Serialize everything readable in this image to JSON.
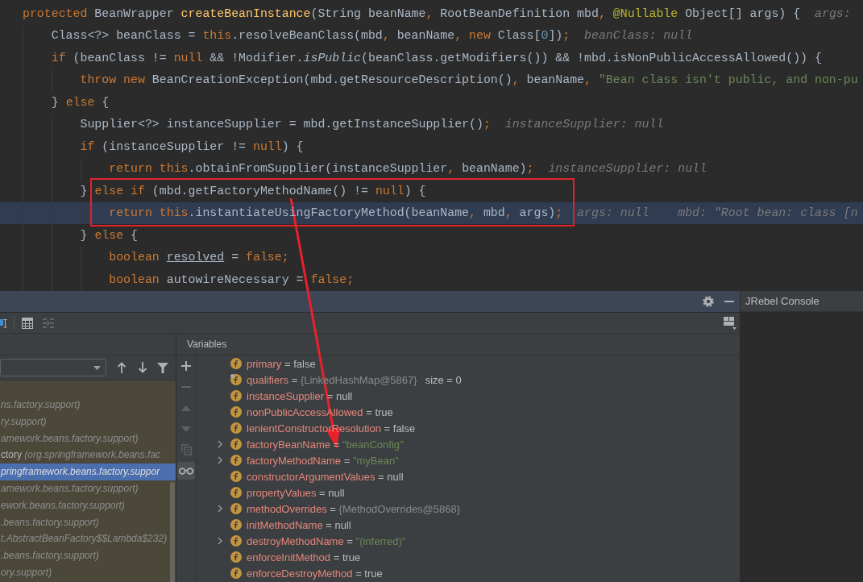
{
  "editor": {
    "lines": [
      {
        "tokens": [
          {
            "text": "protected",
            "kind": "keyword"
          },
          {
            "text": " BeanWrapper ",
            "kind": "plain"
          },
          {
            "text": "createBeanInstance",
            "kind": "method"
          },
          {
            "text": "(String beanName",
            "kind": "plain"
          },
          {
            "text": ", ",
            "kind": "punct"
          },
          {
            "text": "RootBeanDefinition mbd",
            "kind": "plain"
          },
          {
            "text": ", ",
            "kind": "punct"
          },
          {
            "text": "@Nullable",
            "kind": "annotation"
          },
          {
            "text": " Object[] args) {",
            "kind": "plain"
          }
        ],
        "hints": [
          "args:"
        ],
        "current": false,
        "children": [
          {
            "tokens": [
              {
                "text": "Class<?> beanClass = ",
                "kind": "plain"
              },
              {
                "text": "this",
                "kind": "keyword"
              },
              {
                "text": ".resolveBeanClass(mbd",
                "kind": "plain"
              },
              {
                "text": ", ",
                "kind": "punct"
              },
              {
                "text": "beanName",
                "kind": "plain"
              },
              {
                "text": ", ",
                "kind": "punct"
              },
              {
                "text": "new",
                "kind": "keyword"
              },
              {
                "text": " Class[",
                "kind": "plain"
              },
              {
                "text": "0",
                "kind": "number"
              },
              {
                "text": "])",
                "kind": "plain"
              },
              {
                "text": ";",
                "kind": "punct"
              }
            ],
            "hints": [
              "beanClass: null"
            ],
            "current": false
          },
          {
            "tokens": [
              {
                "text": "if",
                "kind": "keyword"
              },
              {
                "text": " (beanClass != ",
                "kind": "plain"
              },
              {
                "text": "null",
                "kind": "keyword"
              },
              {
                "text": " && !Modifier.",
                "kind": "plain"
              },
              {
                "text": "isPublic",
                "kind": "static"
              },
              {
                "text": "(beanClass.getModifiers()) && !mbd.isNonPublicAccessAllowed()) {",
                "kind": "plain"
              }
            ],
            "current": false,
            "children": [
              {
                "tokens": [
                  {
                    "text": "throw new",
                    "kind": "keyword"
                  },
                  {
                    "text": " BeanCreationException(mbd.getResourceDescription()",
                    "kind": "plain"
                  },
                  {
                    "text": ", ",
                    "kind": "punct"
                  },
                  {
                    "text": "beanName",
                    "kind": "plain"
                  },
                  {
                    "text": ", ",
                    "kind": "punct"
                  },
                  {
                    "text": "\"Bean class isn't public, and non-pu",
                    "kind": "string"
                  }
                ],
                "current": false
              }
            ]
          },
          {
            "tokens": [
              {
                "text": "} ",
                "kind": "plain"
              },
              {
                "text": "else",
                "kind": "keyword"
              },
              {
                "text": " {",
                "kind": "plain"
              }
            ],
            "current": false,
            "children": [
              {
                "tokens": [
                  {
                    "text": "Supplier<?> instanceSupplier = mbd.getInstanceSupplier()",
                    "kind": "plain"
                  },
                  {
                    "text": ";",
                    "kind": "punct"
                  }
                ],
                "hints": [
                  "instanceSupplier: null"
                ],
                "current": false
              },
              {
                "tokens": [
                  {
                    "text": "if",
                    "kind": "keyword"
                  },
                  {
                    "text": " (instanceSupplier != ",
                    "kind": "plain"
                  },
                  {
                    "text": "null",
                    "kind": "keyword"
                  },
                  {
                    "text": ") {",
                    "kind": "plain"
                  }
                ],
                "current": false,
                "children": [
                  {
                    "tokens": [
                      {
                        "text": "return this",
                        "kind": "keyword"
                      },
                      {
                        "text": ".obtainFromSupplier(instanceSupplier",
                        "kind": "plain"
                      },
                      {
                        "text": ", ",
                        "kind": "punct"
                      },
                      {
                        "text": "beanName)",
                        "kind": "plain"
                      },
                      {
                        "text": ";",
                        "kind": "punct"
                      }
                    ],
                    "hints": [
                      "instanceSupplier: null"
                    ],
                    "current": false
                  }
                ]
              },
              {
                "tokens": [
                  {
                    "text": "} ",
                    "kind": "plain"
                  },
                  {
                    "text": "else if",
                    "kind": "keyword"
                  },
                  {
                    "text": " (mbd.getFactoryMethodName() != ",
                    "kind": "plain"
                  },
                  {
                    "text": "null",
                    "kind": "keyword"
                  },
                  {
                    "text": ") {",
                    "kind": "plain"
                  }
                ],
                "current": false,
                "children": [
                  {
                    "tokens": [
                      {
                        "text": "return this",
                        "kind": "keyword"
                      },
                      {
                        "text": ".instantiateUsingFactoryMethod(beanName",
                        "kind": "plain"
                      },
                      {
                        "text": ", ",
                        "kind": "punct"
                      },
                      {
                        "text": "mbd",
                        "kind": "plain"
                      },
                      {
                        "text": ", ",
                        "kind": "punct"
                      },
                      {
                        "text": "args)",
                        "kind": "plain"
                      },
                      {
                        "text": ";",
                        "kind": "punct"
                      }
                    ],
                    "hints": [
                      "args: null",
                      "mbd: \"Root bean: class [n"
                    ],
                    "current": true
                  }
                ]
              },
              {
                "tokens": [
                  {
                    "text": "} ",
                    "kind": "plain"
                  },
                  {
                    "text": "else",
                    "kind": "keyword"
                  },
                  {
                    "text": " {",
                    "kind": "plain"
                  }
                ],
                "current": false,
                "children": [
                  {
                    "tokens": [
                      {
                        "text": "boolean ",
                        "kind": "keyword"
                      },
                      {
                        "text": "resolved",
                        "kind": "underlined"
                      },
                      {
                        "text": " = ",
                        "kind": "plain"
                      },
                      {
                        "text": "false",
                        "kind": "keyword"
                      },
                      {
                        "text": ";",
                        "kind": "punct"
                      }
                    ],
                    "current": false
                  },
                  {
                    "tokens": [
                      {
                        "text": "boolean",
                        "kind": "keyword"
                      },
                      {
                        "text": " autowireNecessary = ",
                        "kind": "plain"
                      },
                      {
                        "text": "false",
                        "kind": "keyword"
                      },
                      {
                        "text": ";",
                        "kind": "punct"
                      }
                    ],
                    "current": false
                  }
                ]
              }
            ]
          }
        ]
      }
    ]
  },
  "debugger": {
    "frames": [
      {
        "location": "ns.factory.support)",
        "selected": false
      },
      {
        "location": "ry.support)",
        "selected": false
      },
      {
        "location": "amework.beans.factory.support)",
        "selected": false
      },
      {
        "method": "ctory",
        "location": "(org.springframework.beans.fac",
        "selected": false
      },
      {
        "location": "pringframework.beans.factory.suppor",
        "selected": true
      },
      {
        "location": "amework.beans.factory.support)",
        "selected": false
      },
      {
        "location": "ework.beans.factory.support)",
        "selected": false
      },
      {
        "location": ".beans.factory.support)",
        "selected": false
      },
      {
        "location": "t.AbstractBeanFactory$$Lambda$232)",
        "selected": false
      },
      {
        "location": ".beans.factory.support)",
        "selected": false
      },
      {
        "location": "ory.support)",
        "selected": false
      }
    ],
    "watch_buttons": [
      {
        "kind": "plus",
        "disabled": false,
        "on": false
      },
      {
        "kind": "minus",
        "disabled": true,
        "on": false
      },
      {
        "kind": "up",
        "disabled": true,
        "on": false
      },
      {
        "kind": "down",
        "disabled": true,
        "on": false
      },
      {
        "kind": "copy",
        "disabled": true,
        "on": false
      },
      {
        "kind": "glasses",
        "disabled": false,
        "on": true
      }
    ],
    "variables": {
      "title": "Variables",
      "rows": [
        {
          "name": "primary",
          "separator": "=",
          "value": "false",
          "kind": "plain",
          "expandable": false,
          "marked": false
        },
        {
          "name": "qualifiers",
          "separator": "=",
          "value": "{LinkedHashMap@5867}",
          "kind": "ref",
          "extra": "size = 0",
          "expandable": false,
          "marked": true
        },
        {
          "name": "instanceSupplier",
          "separator": "=",
          "value": "null",
          "kind": "plain",
          "expandable": false,
          "marked": false
        },
        {
          "name": "nonPublicAccessAllowed",
          "separator": "=",
          "value": "true",
          "kind": "plain",
          "expandable": false,
          "marked": false
        },
        {
          "name": "lenientConstructorResolution",
          "separator": "=",
          "value": "false",
          "kind": "plain",
          "expandable": false,
          "marked": false
        },
        {
          "name": "factoryBeanName",
          "separator": "=",
          "value": "\"beanConfig\"",
          "kind": "string",
          "expandable": true,
          "marked": false
        },
        {
          "name": "factoryMethodName",
          "separator": "=",
          "value": "\"myBean\"",
          "kind": "string",
          "expandable": true,
          "marked": false
        },
        {
          "name": "constructorArgumentValues",
          "separator": "=",
          "value": "null",
          "kind": "plain",
          "expandable": false,
          "marked": false
        },
        {
          "name": "propertyValues",
          "separator": "=",
          "value": "null",
          "kind": "plain",
          "expandable": false,
          "marked": false
        },
        {
          "name": "methodOverrides",
          "separator": "=",
          "value": "{MethodOverrides@5868}",
          "kind": "ref",
          "expandable": true,
          "marked": false
        },
        {
          "name": "initMethodName",
          "separator": "=",
          "value": "null",
          "kind": "plain",
          "expandable": false,
          "marked": false
        },
        {
          "name": "destroyMethodName",
          "separator": "=",
          "value": "\"(inferred)\"",
          "kind": "string",
          "expandable": true,
          "marked": false
        },
        {
          "name": "enforceInitMethod",
          "separator": "=",
          "value": "true",
          "kind": "plain",
          "expandable": false,
          "marked": false
        },
        {
          "name": "enforceDestroyMethod",
          "separator": "=",
          "value": "true",
          "kind": "plain",
          "expandable": false,
          "marked": false
        }
      ]
    }
  },
  "side_panel": {
    "tab": "JRebel Console"
  }
}
